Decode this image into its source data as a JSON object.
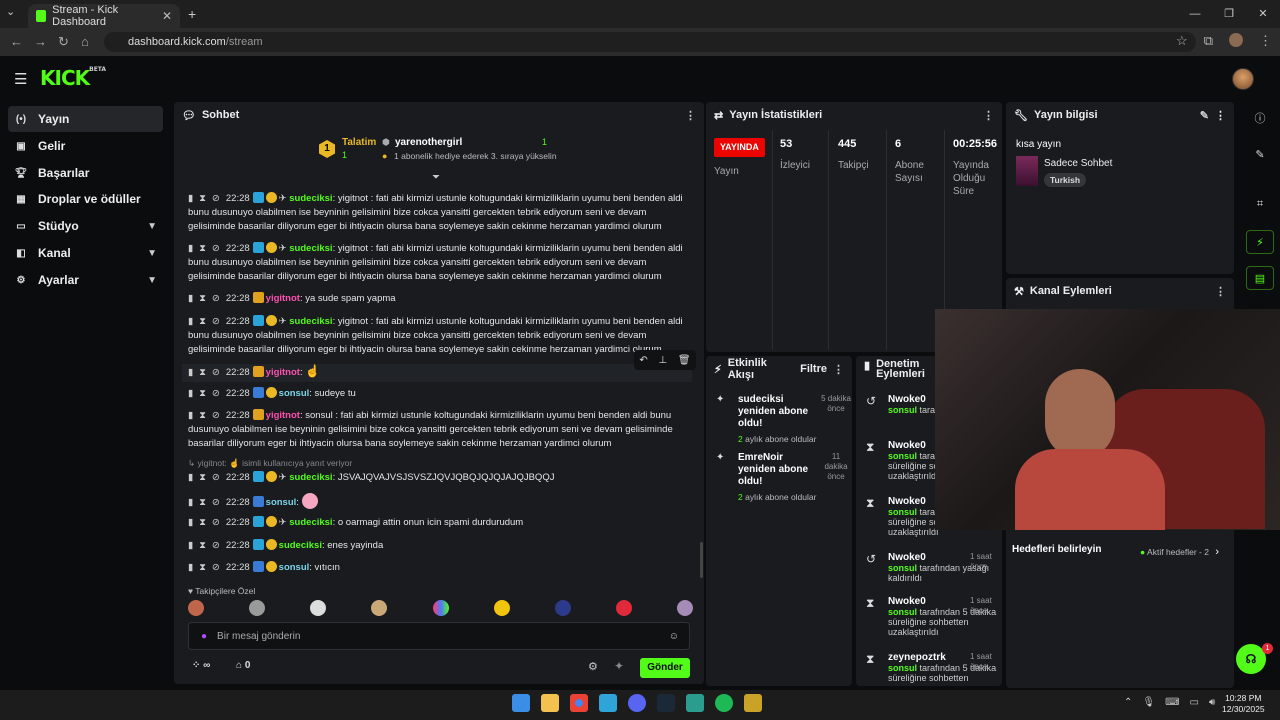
{
  "browser": {
    "tab_title": "Stream - Kick Dashboard",
    "url_host": "dashboard.kick.com",
    "url_path": "/stream"
  },
  "sidebar": {
    "items": [
      {
        "label": "Yayın",
        "icon": "broadcast-icon"
      },
      {
        "label": "Gelir",
        "icon": "revenue-icon"
      },
      {
        "label": "Başarılar",
        "icon": "trophy-icon"
      },
      {
        "label": "Droplar ve ödüller",
        "icon": "gift-icon"
      },
      {
        "label": "Stüdyo",
        "icon": "studio-icon"
      },
      {
        "label": "Kanal",
        "icon": "channel-icon"
      },
      {
        "label": "Ayarlar",
        "icon": "gear-icon"
      }
    ]
  },
  "chat": {
    "title": "Sohbet",
    "pinned": {
      "left_label": "Talatim",
      "left_count": "1",
      "user": "yarenothergirl",
      "count": "1",
      "text": "1 abonelik hediye ederek 3. sıraya yükselin"
    },
    "reply_hint": "yigitnot:",
    "reply_text": "isimli kullanıcıya yanıt veriyor",
    "followers_only": "Takipçilere Özel",
    "input_placeholder": "Bir mesaj gönderin",
    "infinity_label": "∞",
    "counter": "0",
    "send_label": "Gönder",
    "messages": [
      {
        "time": "22:28",
        "user": "sudeciksi",
        "text": ": yigitnot : fati abi kirmizi ustunle koltugundaki kirmiziliklarin uyumu beni benden aldi bunu dusunuyo olabilmen ise beyninin gelisimini bize cokca yansitti gercekten tebrik ediyorum seni ve devam gelisiminde basarilar diliyorum eger bi ihtiyacin olursa bana soylemeye sakin cekinme herzaman yardimci olurum"
      },
      {
        "time": "22:28",
        "user": "sudeciksi",
        "text": ": yigitnot : fati abi kirmizi ustunle koltugundaki kirmiziliklarin uyumu beni benden aldi bunu dusunuyo olabilmen ise beyninin gelisimini bize cokca yansitti gercekten tebrik ediyorum seni ve devam gelisiminde basarilar diliyorum eger bi ihtiyacin olursa bana soylemeye sakin cekinme herzaman yardimci olurum"
      },
      {
        "time": "22:28",
        "user": "yigitnot",
        "text": ": ya sude spam yapma"
      },
      {
        "time": "22:28",
        "user": "sudeciksi",
        "text": ": yigitnot : fati abi kirmizi ustunle koltugundaki kirmiziliklarin uyumu beni benden aldi bunu dusunuyo olabilmen ise beyninin gelisimini bize cokca yansitti gercekten tebrik ediyorum seni ve devam gelisiminde basarilar diliyorum eger bi ihtiyacin olursa bana soylemeye sakin cekinme herzaman yardimci olurum"
      },
      {
        "time": "22:28",
        "user": "yigitnot",
        "text": ":"
      },
      {
        "time": "22:28",
        "user": "sonsul",
        "text": ": sudeye tu"
      },
      {
        "time": "22:28",
        "user": "yigitnot",
        "text": ": sonsul : fati abi kirmizi ustunle koltugundaki kirmiziliklarin uyumu beni benden aldi bunu dusunuyo olabilmen ise beyninin gelisimini bize cokca yansitti gercekten tebrik ediyorum seni ve devam gelisiminde basarilar diliyorum eger bi ihtiyacin olursa bana soylemeye sakin cekinme herzaman yardimci olurum"
      },
      {
        "time": "22:28",
        "user": "sudeciksi",
        "text": ": JSVAJQVAJVSJSVSZJQVJQBQJQJQJAJQJBQQJ"
      },
      {
        "time": "22:28",
        "user": "sonsul",
        "text": ":"
      },
      {
        "time": "22:28",
        "user": "sudeciksi",
        "text": ": o oarmagi attin onun icin spami durdurudum"
      },
      {
        "time": "22:28",
        "user": "sudeciksi",
        "text": ": enes yayinda"
      },
      {
        "time": "22:28",
        "user": "sonsul",
        "text": ": vıtıcın"
      }
    ]
  },
  "stats": {
    "title": "Yayın İstatistikleri",
    "live_label": "YAYINDA",
    "live_caption": "Yayın",
    "viewers": "53",
    "viewers_label": "İzleyici",
    "followers": "445",
    "followers_label": "Takipçi",
    "subs": "6",
    "subs_label": "Abone Sayısı",
    "duration": "00:25:56",
    "duration_label": "Yayında Olduğu Süre"
  },
  "stream_info": {
    "title": "Yayın bilgisi",
    "stream_title": "kısa yayın",
    "category": "Sadece Sohbet",
    "language": "Turkish"
  },
  "channel_actions": {
    "title": "Kanal Eylemleri"
  },
  "goals": {
    "title": "Hedefleri belirleyin",
    "active": "Aktif hedefler - 2"
  },
  "activity": {
    "title": "Etkinlik Akışı",
    "filter": "Filtre",
    "items": [
      {
        "name": "sudeciksi yeniden abone oldu!",
        "count": "2",
        "suffix": "aylık abone oldular",
        "time": "5 dakika önce"
      },
      {
        "name": "EmreNoir yeniden abone oldu!",
        "count": "2",
        "suffix": "aylık abone oldular",
        "time": "11 dakika önce"
      }
    ]
  },
  "moderation": {
    "title": "Denetim Eylemleri",
    "items": [
      {
        "user": "Nwoke0",
        "time": "",
        "actor": "sonsul",
        "text": "tarafından kaldırıldı"
      },
      {
        "user": "Nwoke0",
        "time": "",
        "actor": "sonsul",
        "text": "tarafından süreliğine sohbetten uzaklaştırıldı"
      },
      {
        "user": "Nwoke0",
        "time": "",
        "actor": "sonsul",
        "text": "tarafından süreliğine sohbetten uzaklaştırıldı"
      },
      {
        "user": "Nwoke0",
        "time": "1 saat önce",
        "actor": "sonsul",
        "text": "tarafından yasağı kaldırıldı"
      },
      {
        "user": "Nwoke0",
        "time": "1 saat önce",
        "actor": "sonsul",
        "text": "tarafından 5 dakika süreliğine sohbetten uzaklaştırıldı"
      },
      {
        "user": "zeynepoztrk",
        "time": "1 saat önce",
        "actor": "sonsul",
        "text": "tarafından 5 dakika süreliğine sohbetten"
      }
    ]
  },
  "notif_badge": "1",
  "clock": {
    "time": "10:28 PM",
    "date": "12/30/2025"
  }
}
